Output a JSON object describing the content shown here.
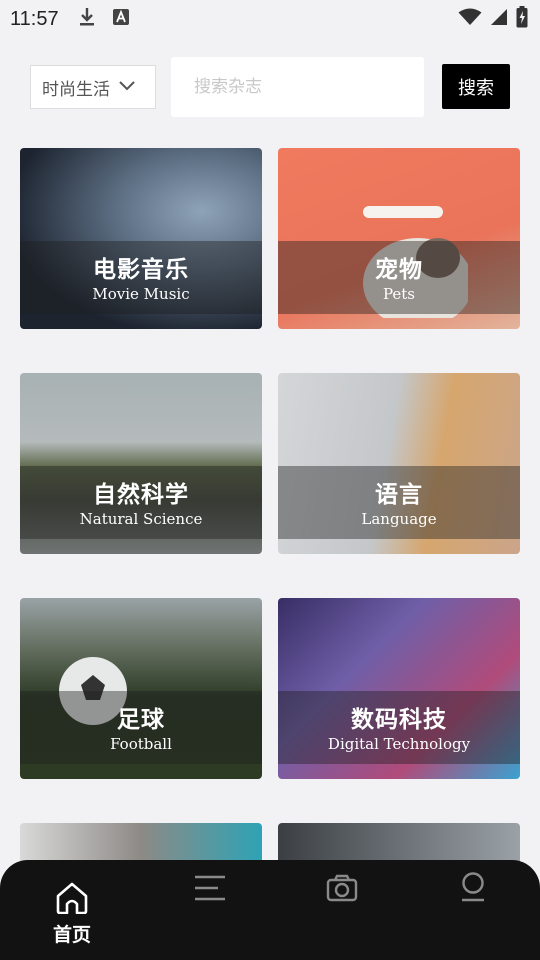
{
  "status_bar": {
    "time": "11:57",
    "left_icons": [
      "download-icon",
      "a-badge-icon"
    ],
    "right_icons": [
      "wifi-icon",
      "cellular-icon",
      "battery-icon"
    ]
  },
  "search": {
    "category": "时尚生活",
    "placeholder": "搜索杂志",
    "button_label": "搜索"
  },
  "categories": [
    {
      "cn": "电影音乐",
      "en": "Movie Music"
    },
    {
      "cn": "宠物",
      "en": "Pets"
    },
    {
      "cn": "自然科学",
      "en": "Natural Science"
    },
    {
      "cn": "语言",
      "en": "Language"
    },
    {
      "cn": "足球",
      "en": "Football"
    },
    {
      "cn": "数码科技",
      "en": "Digital Technology"
    }
  ],
  "bottom_nav": [
    {
      "icon": "home-icon",
      "label": "首页",
      "active": true
    },
    {
      "icon": "menu-icon",
      "label": "",
      "active": false
    },
    {
      "icon": "camera-icon",
      "label": "",
      "active": false
    },
    {
      "icon": "user-icon",
      "label": "",
      "active": false
    }
  ],
  "colors": {
    "background": "#f2f2f4",
    "search_button": "#000000",
    "nav_background": "#121212",
    "nav_active": "#ffffff",
    "nav_inactive": "#8a8a8a"
  }
}
